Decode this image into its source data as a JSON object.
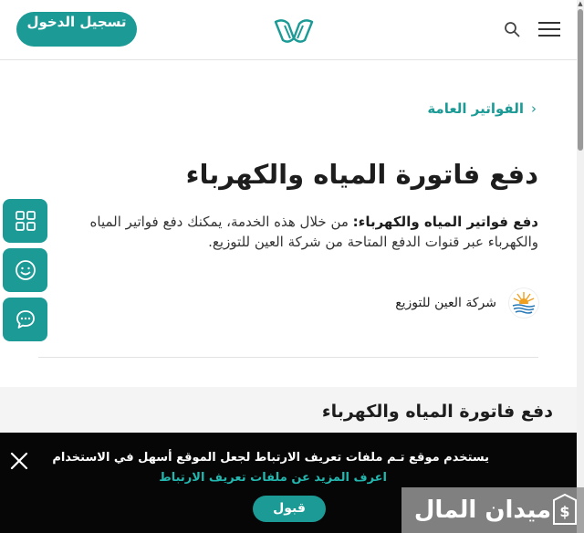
{
  "header": {
    "login_label": "تسجيل الدخول",
    "logo_icon": "emirate-logo-icon",
    "search_icon": "search-icon",
    "menu_icon": "hamburger-menu-icon"
  },
  "breadcrumb": {
    "label": "الفواتير العامة",
    "chevron": "‹"
  },
  "main": {
    "title": "دفع فاتورة المياه والكهرباء",
    "desc_bold": "دفع فواتير المياه والكهرباء:",
    "desc_rest": " من خلال هذه الخدمة، يمكنك دفع فواتير المياه والكهرباء عبر قنوات الدفع المتاحة من شركة العين للتوزيع."
  },
  "provider": {
    "name": "شركة العين للتوزيع"
  },
  "side_buttons": [
    {
      "icon": "grid-icon"
    },
    {
      "icon": "smiley-icon"
    },
    {
      "icon": "chat-icon"
    }
  ],
  "lower": {
    "title": "دفع فاتورة المياه والكهرباء"
  },
  "cookie": {
    "text": "يستخدم موقع تـم ملفات تعريف الارتباط لجعل الموقع أسهل في الاستخدام",
    "link": "اعرف المزيد عن ملفات تعريف الارتباط",
    "accept_label": "قبول"
  },
  "watermark": {
    "text": "ميدان المال"
  },
  "colors": {
    "accent": "#1b9a96",
    "banner_bg": "#060606"
  }
}
